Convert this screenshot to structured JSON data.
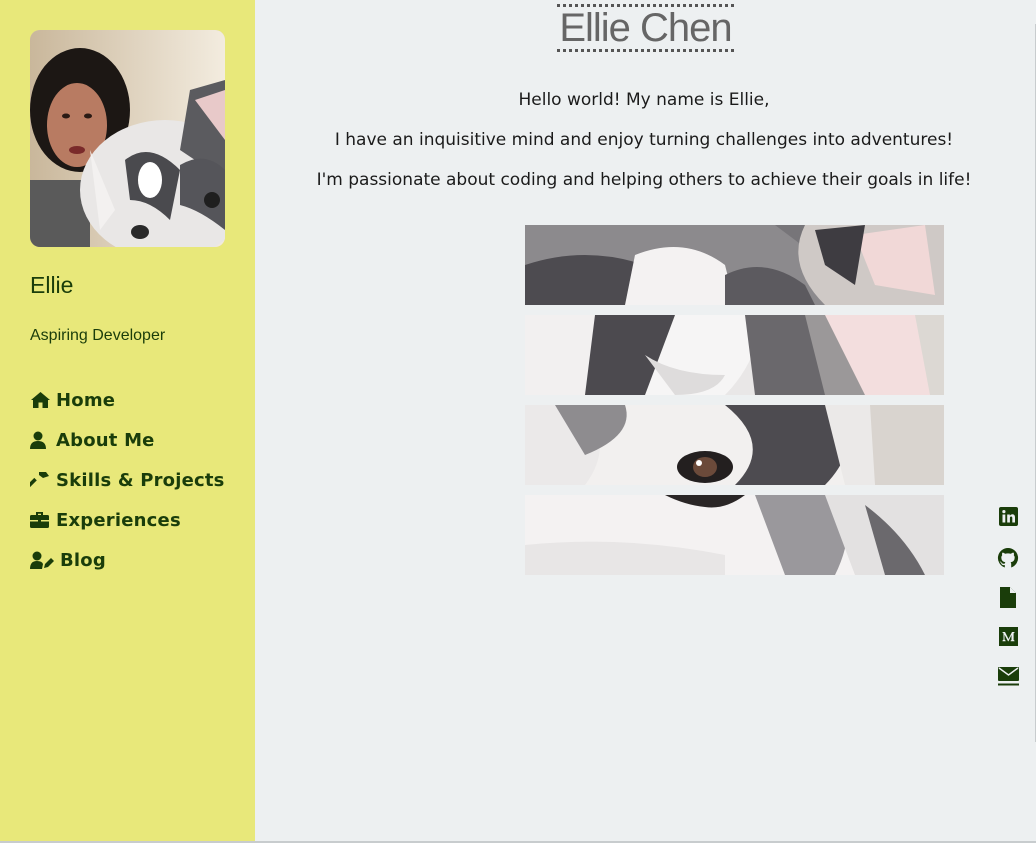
{
  "sidebar": {
    "profile_name": "Ellie",
    "profile_role": "Aspiring Developer",
    "background_color": "#e8e87a",
    "text_color": "#1a3d0a",
    "nav_items": [
      {
        "label": "Home",
        "icon": "home-icon"
      },
      {
        "label": "About Me",
        "icon": "user-icon"
      },
      {
        "label": "Skills & Projects",
        "icon": "hammer-icon"
      },
      {
        "label": "Experiences",
        "icon": "briefcase-icon"
      },
      {
        "label": "Blog",
        "icon": "user-edit-icon"
      }
    ]
  },
  "main": {
    "title": "Ellie Chen",
    "intro_lines": [
      "Hello world! My name is Ellie,",
      "I have an inquisitive mind and enjoy turning challenges into adventures!",
      "I'm passionate about coding and helping others to achieve their goals in life!"
    ],
    "background_color": "#edf0f1"
  },
  "social_links": [
    {
      "icon": "linkedin-icon"
    },
    {
      "icon": "github-icon"
    },
    {
      "icon": "resume-file-icon"
    },
    {
      "icon": "medium-icon"
    },
    {
      "icon": "email-icon"
    }
  ]
}
